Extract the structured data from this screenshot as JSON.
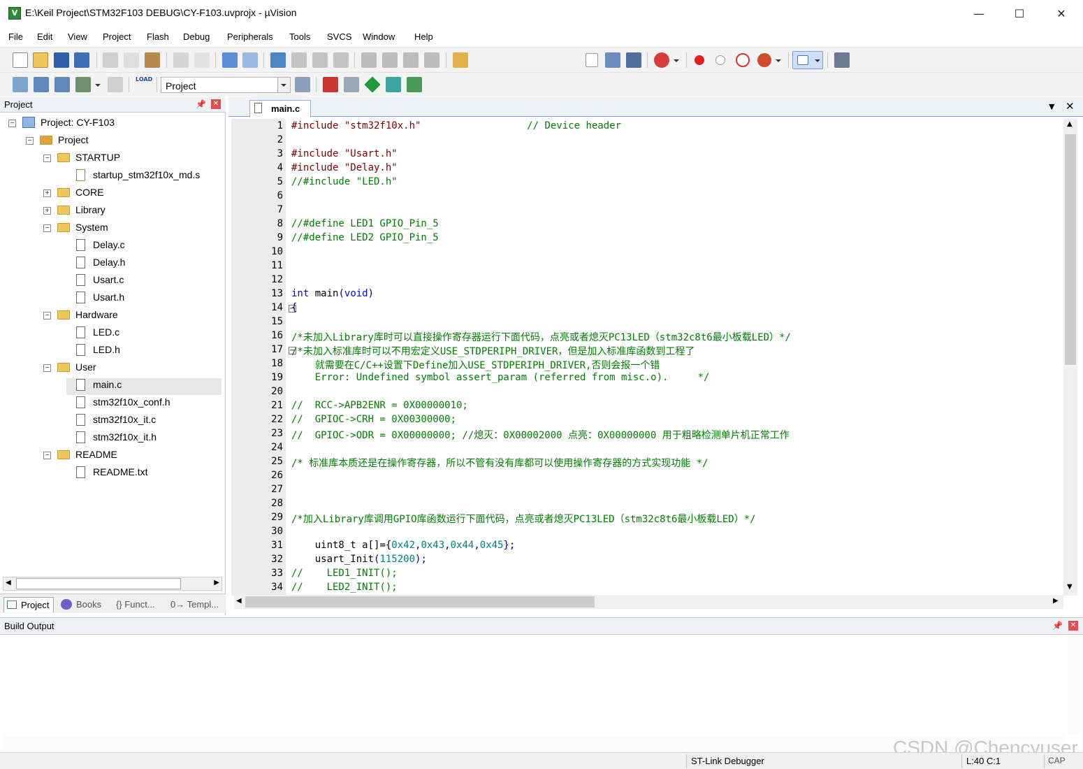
{
  "window": {
    "title": "E:\\Keil Project\\STM32F103 DEBUG\\CY-F103.uvprojx - µVision",
    "app_icon_letter": "V",
    "minimize": "—",
    "maximize": "☐",
    "close": "✕"
  },
  "menu": [
    "File",
    "Edit",
    "View",
    "Project",
    "Flash",
    "Debug",
    "Peripherals",
    "Tools",
    "SVCS",
    "Window",
    "Help"
  ],
  "toolbar2": {
    "load_label": "LOAD",
    "target_select": "Project"
  },
  "project_panel": {
    "title": "Project",
    "tree": [
      {
        "label": "Project: CY-F103",
        "type": "project"
      },
      {
        "label": "Project",
        "type": "group"
      },
      {
        "label": "STARTUP",
        "type": "folder"
      },
      {
        "label": "startup_stm32f10x_md.s",
        "type": "file"
      },
      {
        "label": "CORE",
        "type": "folder"
      },
      {
        "label": "Library",
        "type": "folder"
      },
      {
        "label": "System",
        "type": "folder"
      },
      {
        "label": "Delay.c",
        "type": "file"
      },
      {
        "label": "Delay.h",
        "type": "file"
      },
      {
        "label": "Usart.c",
        "type": "file"
      },
      {
        "label": "Usart.h",
        "type": "file"
      },
      {
        "label": "Hardware",
        "type": "folder"
      },
      {
        "label": "LED.c",
        "type": "file"
      },
      {
        "label": "LED.h",
        "type": "file"
      },
      {
        "label": "User",
        "type": "folder"
      },
      {
        "label": "main.c",
        "type": "file"
      },
      {
        "label": "stm32f10x_conf.h",
        "type": "file"
      },
      {
        "label": "stm32f10x_it.c",
        "type": "file"
      },
      {
        "label": "stm32f10x_it.h",
        "type": "file"
      },
      {
        "label": "README",
        "type": "folder"
      },
      {
        "label": "README.txt",
        "type": "file"
      }
    ],
    "tabs": [
      "Project",
      "Books",
      "{} Funct...",
      "0→ Templ..."
    ]
  },
  "editor": {
    "active_tab": "main.c",
    "line_numbers": [
      "1",
      "2",
      "3",
      "4",
      "5",
      "6",
      "7",
      "8",
      "9",
      "10",
      "11",
      "12",
      "13",
      "14",
      "15",
      "16",
      "17",
      "18",
      "19",
      "20",
      "21",
      "22",
      "23",
      "24",
      "25",
      "26",
      "27",
      "28",
      "29",
      "30",
      "31",
      "32",
      "33",
      "34"
    ],
    "lines": [
      [
        "#include \"stm32f10x.h\"",
        "                  // Device header"
      ],
      [],
      [
        "#include \"Usart.h\""
      ],
      [
        "#include \"Delay.h\""
      ],
      [
        "//#include \"LED.h\""
      ],
      [],
      [],
      [
        "//#define LED1 GPIO_Pin_5"
      ],
      [
        "//#define LED2 GPIO_Pin_5"
      ],
      [],
      [],
      [],
      [
        "int",
        " main",
        "(",
        "void",
        ")"
      ],
      [
        "{"
      ],
      [],
      [
        "/*未加入Library库时可以直接操作寄存器运行下面代码，点亮或者熄灭PC13LED（stm32c8t6最小板载LED）*/"
      ],
      [
        "/*未加入标准库时可以不用宏定义USE_STDPERIPH_DRIVER，但是加入标准库函数到工程了"
      ],
      [
        "    就需要在C/C++设置下Define加入USE_STDPERIPH_DRIVER,否则会报一个错"
      ],
      [
        "    Error: Undefined symbol assert_param (referred from misc.o).     */"
      ],
      [],
      [
        "//  RCC->APB2ENR = 0X00000010;"
      ],
      [
        "//  GPIOC->CRH = 0X00300000;"
      ],
      [
        "//  GPIOC->ODR = 0X00000000; //熄灭：0X00002000 点亮：0X00000000 用于粗略检测单片机正常工作"
      ],
      [],
      [
        "/* 标准库本质还是在操作寄存器，所以不管有没有库都可以使用操作寄存器的方式实现功能 */"
      ],
      [],
      [],
      [],
      [
        "/*加入Library库调用GPIO库函数运行下面代码，点亮或者熄灭PC13LED（stm32c8t6最小板载LED）*/"
      ],
      [],
      [
        "    uint8_t a[]={",
        "0x42",
        ",",
        "0x43",
        ",",
        "0x44",
        ",",
        "0x45",
        "};"
      ],
      [
        "    usart_Init",
        "(",
        "115200",
        ");"
      ],
      [
        "//    LED1_INIT();"
      ],
      [
        "//    LED2_INIT();"
      ]
    ]
  },
  "build_output": {
    "title": "Build Output"
  },
  "status": {
    "debugger": "ST-Link Debugger",
    "position": "L:40 C:1",
    "caps": "CAP",
    "watermark": "CSDN @Chencyuser"
  }
}
